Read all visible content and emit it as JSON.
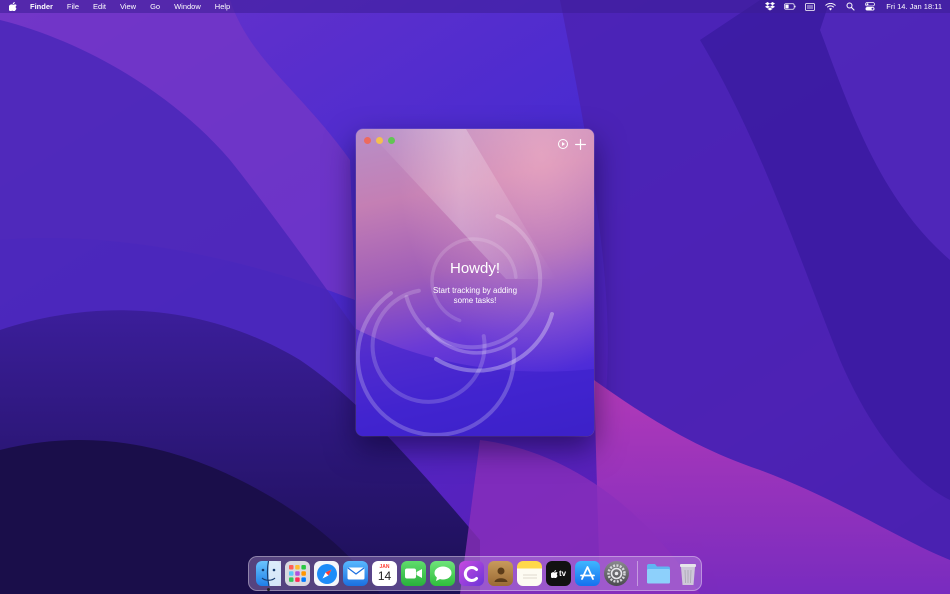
{
  "menubar": {
    "app_name": "Finder",
    "menus": [
      "File",
      "Edit",
      "View",
      "Go",
      "Window",
      "Help"
    ],
    "clock": "Fri 14. Jan  18:11",
    "status_icons": [
      "dropbox-icon",
      "battery-icon",
      "keyboard-icon",
      "wifi-icon",
      "spotlight-icon",
      "control-center-icon"
    ]
  },
  "window": {
    "title": "Howdy!",
    "subtitle": "Start tracking by adding some tasks!",
    "toolbar": [
      "timer-icon",
      "add-icon"
    ]
  },
  "dock": {
    "calendar_month": "JAN",
    "calendar_day": "14",
    "tv_label": "tv",
    "apps": [
      "finder",
      "launchpad",
      "safari",
      "mail",
      "calendar",
      "facetime",
      "messages",
      "cashculator",
      "contacts",
      "notes",
      "apple-tv",
      "app-store",
      "system-preferences",
      "downloads-folder",
      "trash"
    ],
    "colors": {
      "accent": "#3f24c8",
      "window_top": "#c47fb4"
    }
  }
}
